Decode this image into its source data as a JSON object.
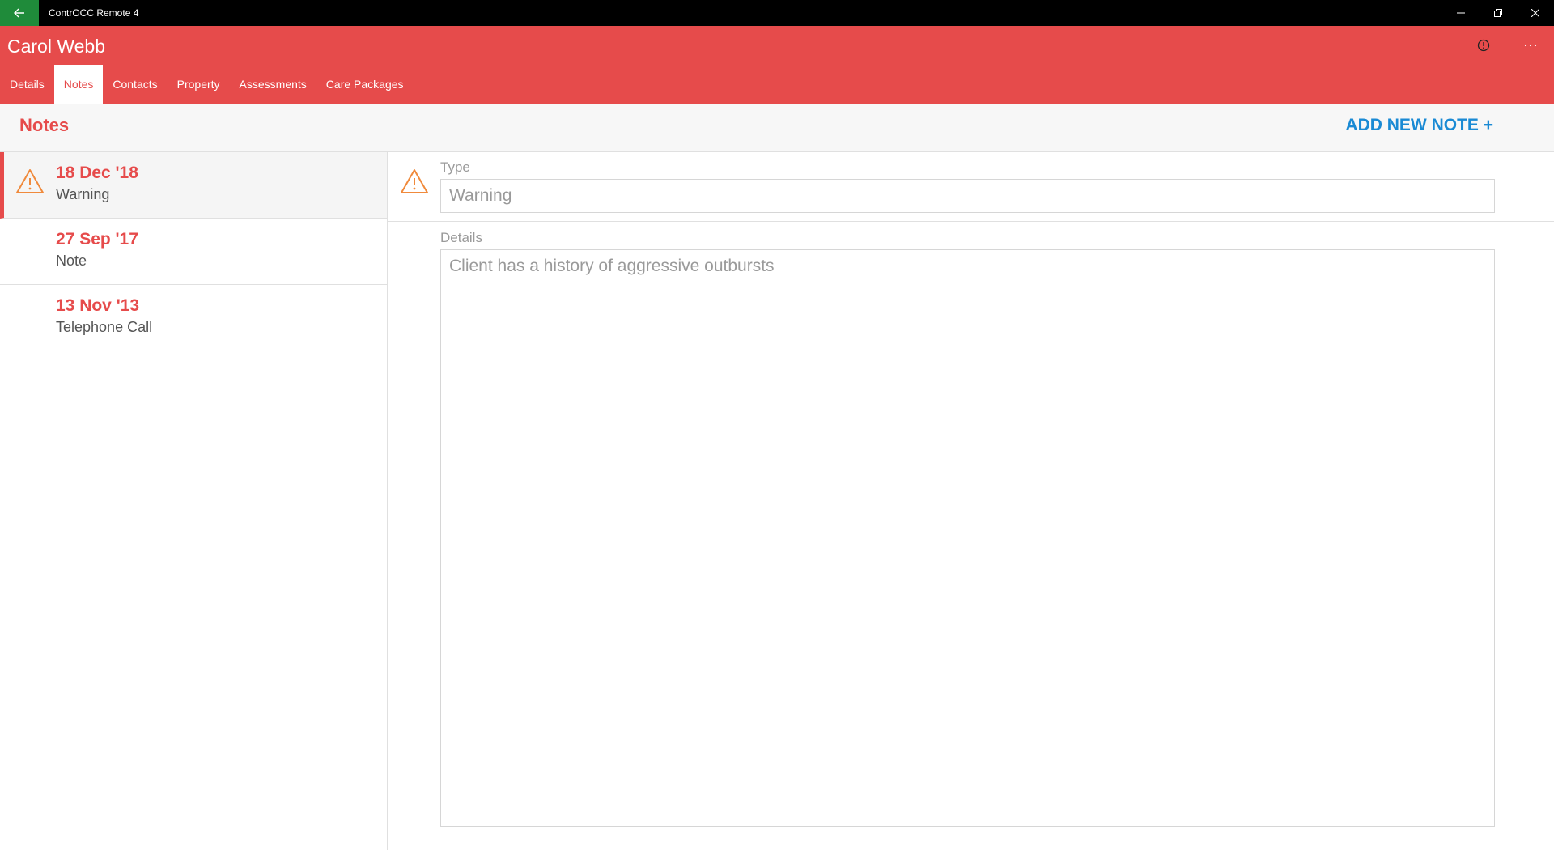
{
  "window": {
    "title": "ContrOCC Remote 4"
  },
  "header": {
    "client_name": "Carol Webb",
    "tabs": [
      {
        "label": "Details"
      },
      {
        "label": "Notes"
      },
      {
        "label": "Contacts"
      },
      {
        "label": "Property"
      },
      {
        "label": "Assessments"
      },
      {
        "label": "Care Packages"
      }
    ],
    "active_tab": "Notes",
    "icons": [
      "info-icon",
      "more-icon"
    ]
  },
  "section": {
    "title": "Notes",
    "add_label": "ADD NEW NOTE +"
  },
  "notes": [
    {
      "date": "18 Dec '18",
      "type": "Warning",
      "icon": "warning-icon",
      "selected": true
    },
    {
      "date": "27 Sep '17",
      "type": "Note",
      "selected": false
    },
    {
      "date": "13 Nov '13",
      "type": "Telephone Call",
      "selected": false
    }
  ],
  "detail": {
    "type_label": "Type",
    "type_value": "Warning",
    "details_label": "Details",
    "details_value": "Client has a history of aggressive outbursts"
  },
  "colors": {
    "accent": "#e64b4b",
    "link": "#1a8ad4",
    "warning": "#f08a3c",
    "back_button": "#1f8b3a"
  }
}
